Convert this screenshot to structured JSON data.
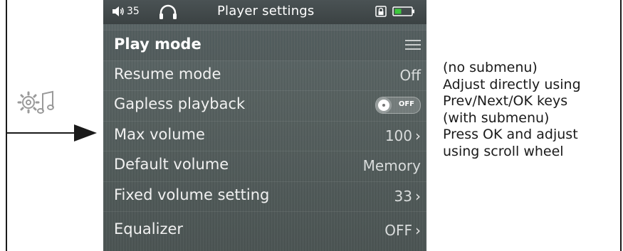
{
  "status_bar": {
    "volume": "35",
    "title": "Player settings",
    "icons": [
      "speaker-icon",
      "headphone-icon",
      "lock-icon",
      "battery-icon"
    ]
  },
  "menu": {
    "header": {
      "label": "Play mode",
      "icon": "hamburger-menu-icon"
    },
    "items": [
      {
        "label": "Resume mode",
        "value": "Off",
        "chevron": false
      },
      {
        "label": "Gapless playback",
        "toggle": "OFF"
      },
      {
        "label": "Max volume",
        "value": "100",
        "chevron": true
      },
      {
        "label": "Default volume",
        "value": "Memory",
        "chevron": false
      },
      {
        "label": "Fixed volume setting",
        "value": "33",
        "chevron": true
      },
      {
        "label": "Equalizer",
        "value": "OFF",
        "chevron": true
      }
    ],
    "chevron_glyph": "›"
  },
  "description": {
    "lines": [
      "(no submenu)",
      "Adjust directly using",
      "Prev/Next/OK keys",
      "(with submenu)",
      "Press OK and adjust",
      "using scroll wheel"
    ]
  },
  "side_icon": "settings-music-icon",
  "colors": {
    "screen_bg": "#56605f",
    "text_light": "#f1f1f1",
    "battery_fill": "#3ec93e"
  }
}
